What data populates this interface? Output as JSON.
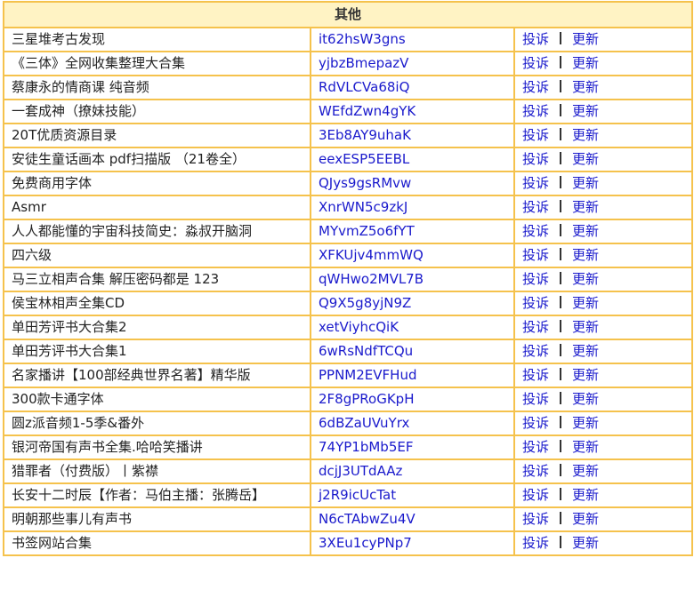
{
  "section_title": "其他",
  "actions": {
    "report": "投诉",
    "update": "更新"
  },
  "rows": [
    {
      "name": "三星堆考古发现",
      "code": "it62hsW3gns"
    },
    {
      "name": "《三体》全网收集整理大合集",
      "code": "yjbzBmepazV"
    },
    {
      "name": "蔡康永的情商课 纯音频",
      "code": "RdVLCVa68iQ"
    },
    {
      "name": "一套成神（撩妹技能）",
      "code": "WEfdZwn4gYK"
    },
    {
      "name": "20T优质资源目录",
      "code": "3Eb8AY9uhaK"
    },
    {
      "name": "安徒生童话画本 pdf扫描版 （21卷全）",
      "code": "eexESP5EEBL"
    },
    {
      "name": "免费商用字体",
      "code": "QJys9gsRMvw"
    },
    {
      "name": "Asmr",
      "code": "XnrWN5c9zkJ"
    },
    {
      "name": "人人都能懂的宇宙科技简史：淼叔开脑洞",
      "code": "MYvmZ5o6fYT"
    },
    {
      "name": "四六级",
      "code": "XFKUjv4mmWQ"
    },
    {
      "name": "马三立相声合集 解压密码都是 123",
      "code": "qWHwo2MVL7B"
    },
    {
      "name": "侯宝林相声全集CD",
      "code": "Q9X5g8yjN9Z"
    },
    {
      "name": "单田芳评书大合集2",
      "code": "xetViyhcQiK"
    },
    {
      "name": "单田芳评书大合集1",
      "code": "6wRsNdfTCQu"
    },
    {
      "name": "名家播讲【100部经典世界名著】精华版",
      "code": "PPNM2EVFHud"
    },
    {
      "name": "300款卡通字体",
      "code": "2F8gPRoGKpH"
    },
    {
      "name": "圆z派音频1-5季&番外",
      "code": "6dBZaUVuYrx"
    },
    {
      "name": "银河帝国有声书全集.哈哈笑播讲",
      "code": "74YP1bMb5EF"
    },
    {
      "name": "猎罪者（付费版）丨紫襟",
      "code": "dcjJ3UTdAAz"
    },
    {
      "name": "长安十二时辰【作者：马伯主播：张腾岳】",
      "code": "j2R9icUcTat"
    },
    {
      "name": "明朝那些事儿有声书",
      "code": "N6cTAbwZu4V"
    },
    {
      "name": "书签网站合集",
      "code": "3XEu1cyPNp7"
    }
  ]
}
